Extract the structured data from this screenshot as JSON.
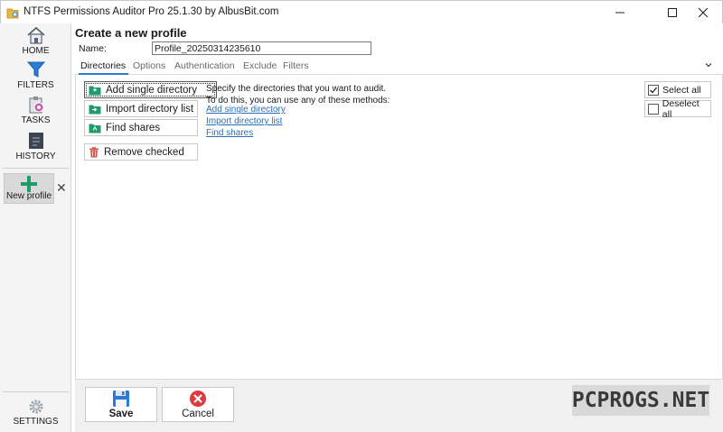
{
  "window": {
    "title": "NTFS Permissions Auditor Pro 25.1.30 by AlbusBit.com",
    "controls": {
      "minimize": "minimize-icon",
      "maximize": "maximize-icon",
      "close": "close-icon"
    }
  },
  "nav": {
    "items": [
      {
        "label": "HOME",
        "icon": "home-icon"
      },
      {
        "label": "FILTERS",
        "icon": "funnel-icon"
      },
      {
        "label": "TASKS",
        "icon": "tasks-icon"
      },
      {
        "label": "HISTORY",
        "icon": "history-icon"
      }
    ],
    "new_profile": {
      "label": "New profile",
      "icon": "plus-icon",
      "close_glyph": "✕"
    },
    "settings": {
      "label": "SETTINGS",
      "icon": "gear-icon"
    }
  },
  "profile": {
    "page_title": "Create a new profile",
    "name_label": "Name:",
    "name_value": "Profile_20250314235610"
  },
  "tabs": {
    "items": [
      "Directories",
      "Options",
      "Authentication",
      "Exclude",
      "Filters"
    ],
    "active": "Directories"
  },
  "directories": {
    "actions": {
      "add_single": "Add single directory",
      "import_list": "Import directory list",
      "find_shares": "Find shares",
      "remove_checked": "Remove checked"
    },
    "description": {
      "line1": "Specify the directories that you want to audit.",
      "line2": "To do this, you can use any of these methods:"
    },
    "links": {
      "add_single": "Add single directory",
      "import_list": "Import directory list",
      "find_shares": "Find shares"
    },
    "select_all": {
      "label": "Select all",
      "checked": true
    },
    "deselect_all": {
      "label": "Deselect all",
      "checked": false
    }
  },
  "footer": {
    "save_label": "Save",
    "cancel_label": "Cancel"
  },
  "watermark": "PCPROGS.NET",
  "colors": {
    "accent": "#2c7ad6",
    "link": "#2a6fb8",
    "folder_green": "#1e9c6a",
    "remove_red": "#d9534f",
    "cancel_red": "#e0393e",
    "nav_blue": "#2b7bd6"
  }
}
